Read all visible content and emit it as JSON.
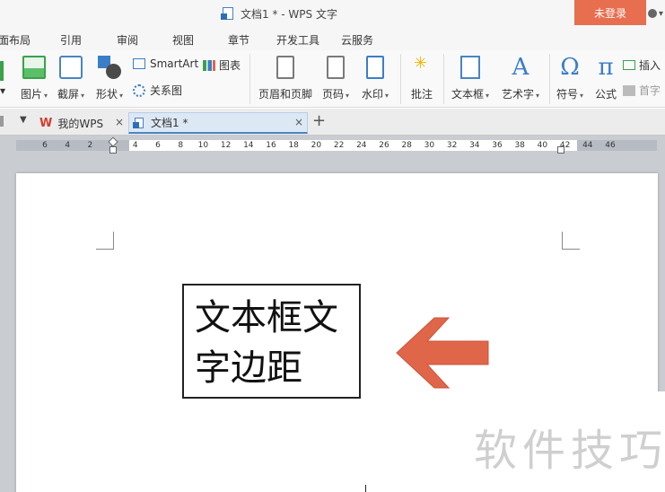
{
  "window": {
    "title": "文档1 * - WPS 文字",
    "login_label": "未登录"
  },
  "menu": {
    "tabs": [
      "面布局",
      "引用",
      "审阅",
      "视图",
      "章节",
      "开发工具",
      "云服务"
    ]
  },
  "ribbon": {
    "picture": "图片",
    "screenshot": "截屏",
    "shape": "形状",
    "smartart": "SmartArt",
    "chart": "图表",
    "relation": "关系图",
    "header_footer": "页眉和页脚",
    "page_number": "页码",
    "watermark": "水印",
    "comment": "批注",
    "textbox": "文本框",
    "wordart": "艺术字",
    "symbol": "符号",
    "formula": "公式",
    "insert": "插入",
    "dropcap": "首字",
    "omega_glyph": "Ω",
    "pi_glyph": "π",
    "a_glyph": "A"
  },
  "tabs": {
    "my_wps": "我的WPS",
    "doc": "文档1 *",
    "close": "×",
    "add": "+"
  },
  "ruler": {
    "ticks": [
      "6",
      "4",
      "2",
      "2",
      "4",
      "6",
      "8",
      "10",
      "12",
      "14",
      "16",
      "18",
      "20",
      "22",
      "24",
      "26",
      "28",
      "30",
      "32",
      "34",
      "36",
      "38",
      "40",
      "42",
      "44",
      "46"
    ]
  },
  "document": {
    "textbox_text": "文本框文字边距",
    "arrow_color": "#e0664a"
  },
  "watermark": {
    "text": "软件技巧"
  }
}
